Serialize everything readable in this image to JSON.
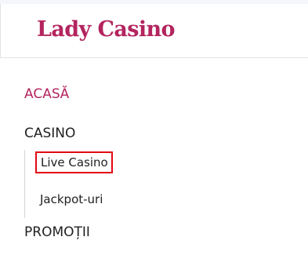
{
  "header": {
    "logo_text": "Lady Casino"
  },
  "nav": {
    "home_label": "ACASĂ",
    "casino_label": "CASINO",
    "casino_submenu": [
      {
        "label": "Live Casino",
        "highlighted": true
      },
      {
        "label": "Jackpot-uri",
        "highlighted": false
      }
    ],
    "promo_label": "PROMOȚII"
  },
  "colors": {
    "brand": "#b3245e",
    "highlight_border": "#e30613",
    "divider": "#e2e2e2"
  }
}
